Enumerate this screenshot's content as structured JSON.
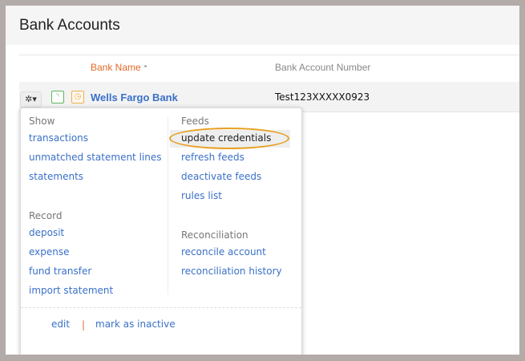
{
  "title": "Bank Accounts",
  "table": {
    "col_bank_name": "Bank Name",
    "sort_icon": "⌃",
    "col_account_number": "Bank Account Number"
  },
  "row": {
    "bank_name": "Wells Fargo Bank",
    "account_number": "Test123XXXXX0923"
  },
  "menu": {
    "show_heading": "Show",
    "show_items": [
      "transactions",
      "unmatched statement lines",
      "statements"
    ],
    "record_heading": "Record",
    "record_items": [
      "deposit",
      "expense",
      "fund transfer",
      "import statement"
    ],
    "feeds_heading": "Feeds",
    "feeds_items": [
      "update credentials",
      "refresh feeds",
      "deactivate feeds",
      "rules list"
    ],
    "reconciliation_heading": "Reconciliation",
    "reconciliation_items": [
      "reconcile account",
      "reconciliation history"
    ],
    "edit": "edit",
    "separator": "|",
    "mark_inactive": "mark as inactive"
  },
  "colors": {
    "link": "#3a70c8",
    "accent": "#e06a2a",
    "highlight": "#e8a020"
  }
}
